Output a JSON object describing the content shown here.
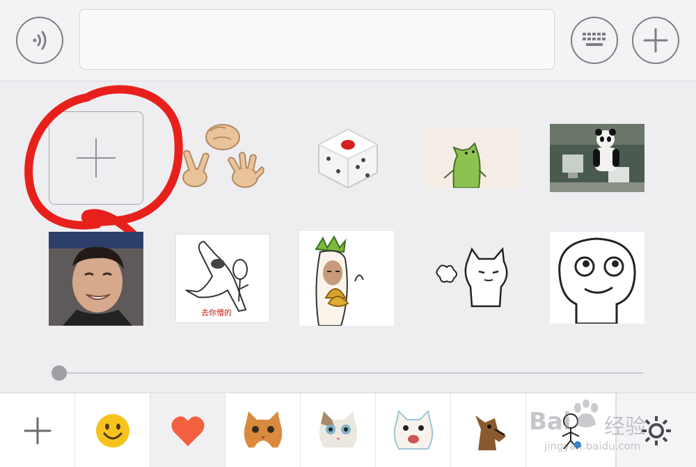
{
  "input_bar": {
    "voice_icon": "voice-wave-icon",
    "keyboard_icon": "keyboard-icon",
    "more_icon": "plus-icon",
    "text_value": ""
  },
  "stickers": {
    "add_icon": "plus-icon",
    "row1": [
      "rock-paper-scissors-hands",
      "dice",
      "green-frog-gif",
      "panda-office-gif"
    ],
    "row2": [
      "laughing-man-gif",
      "crane-meme",
      "radish-poop-meme",
      "cat-sigh-meme",
      "smiling-blob-meme"
    ],
    "crane_caption": "去你懵的"
  },
  "tabbar": {
    "tabs": [
      "add-pack",
      "emoji",
      "favorites-heart",
      "cat-pack-1",
      "cat-pack-2",
      "cat-pack-3",
      "dog-pack",
      "cartoon-pack"
    ],
    "settings_icon": "gear-icon"
  },
  "watermark": {
    "brand_left": "Bai",
    "brand_right": "经验",
    "url": "jingyan.baidu.com"
  },
  "colors": {
    "highlight_circle": "#e8201c",
    "emoji_face": "#f6c31d",
    "heart": "#f2603f",
    "dice_dot": "#d81e1e"
  }
}
